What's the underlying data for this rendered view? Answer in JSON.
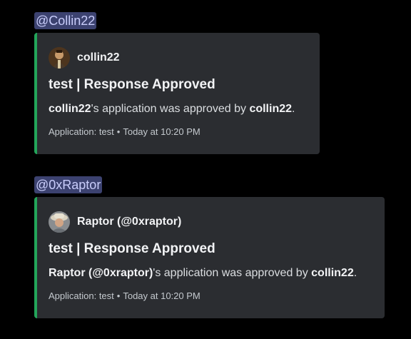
{
  "messages": [
    {
      "mention": "@Collin22",
      "embed": {
        "author": "collin22",
        "title": "test | Response Approved",
        "description": {
          "applicant": "collin22",
          "middle": "'s application was approved by ",
          "approver": "collin22",
          "end": "."
        },
        "footer": {
          "application": "Application: test",
          "separator": "•",
          "time": "Today at 10:20 PM"
        }
      }
    },
    {
      "mention": "@0xRaptor",
      "embed": {
        "author": "Raptor (@0xraptor)",
        "title": "test | Response Approved",
        "description": {
          "applicant": "Raptor (@0xraptor)",
          "middle": "'s application was approved by ",
          "approver": "collin22",
          "end": "."
        },
        "footer": {
          "application": "Application: test",
          "separator": "•",
          "time": "Today at 10:20 PM"
        }
      }
    }
  ],
  "colors": {
    "background": "#000000",
    "embed_background": "#2b2d31",
    "embed_accent": "#23a55a",
    "mention_background": "#3c4270",
    "mention_text": "#c9cdfb"
  }
}
